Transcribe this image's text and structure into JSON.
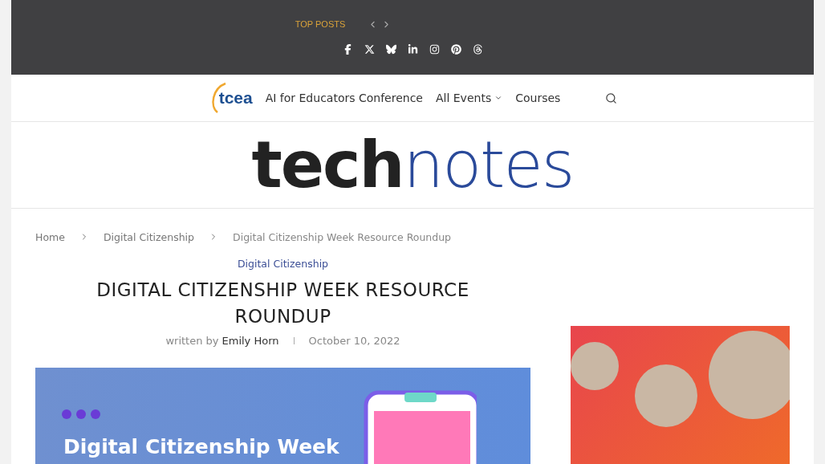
{
  "top_bar": {
    "label": "TOP POSTS"
  },
  "nav": {
    "logo": "tcea",
    "items": [
      {
        "label": "AI for Educators Conference",
        "dropdown": false
      },
      {
        "label": "All Events",
        "dropdown": true
      },
      {
        "label": "Courses",
        "dropdown": false
      }
    ]
  },
  "masthead": {
    "logo_bold": "tech",
    "logo_light": "notes"
  },
  "breadcrumb": [
    "Home",
    "Digital Citizenship",
    "Digital Citizenship Week Resource Roundup"
  ],
  "article": {
    "category": "Digital Citizenship",
    "title": "DIGITAL CITIZENSHIP WEEK RESOURCE ROUNDUP",
    "byline_prefix": "written by",
    "author": "Emily Horn",
    "date": "October 10, 2022",
    "banner_title": "Digital Citizenship Week"
  }
}
